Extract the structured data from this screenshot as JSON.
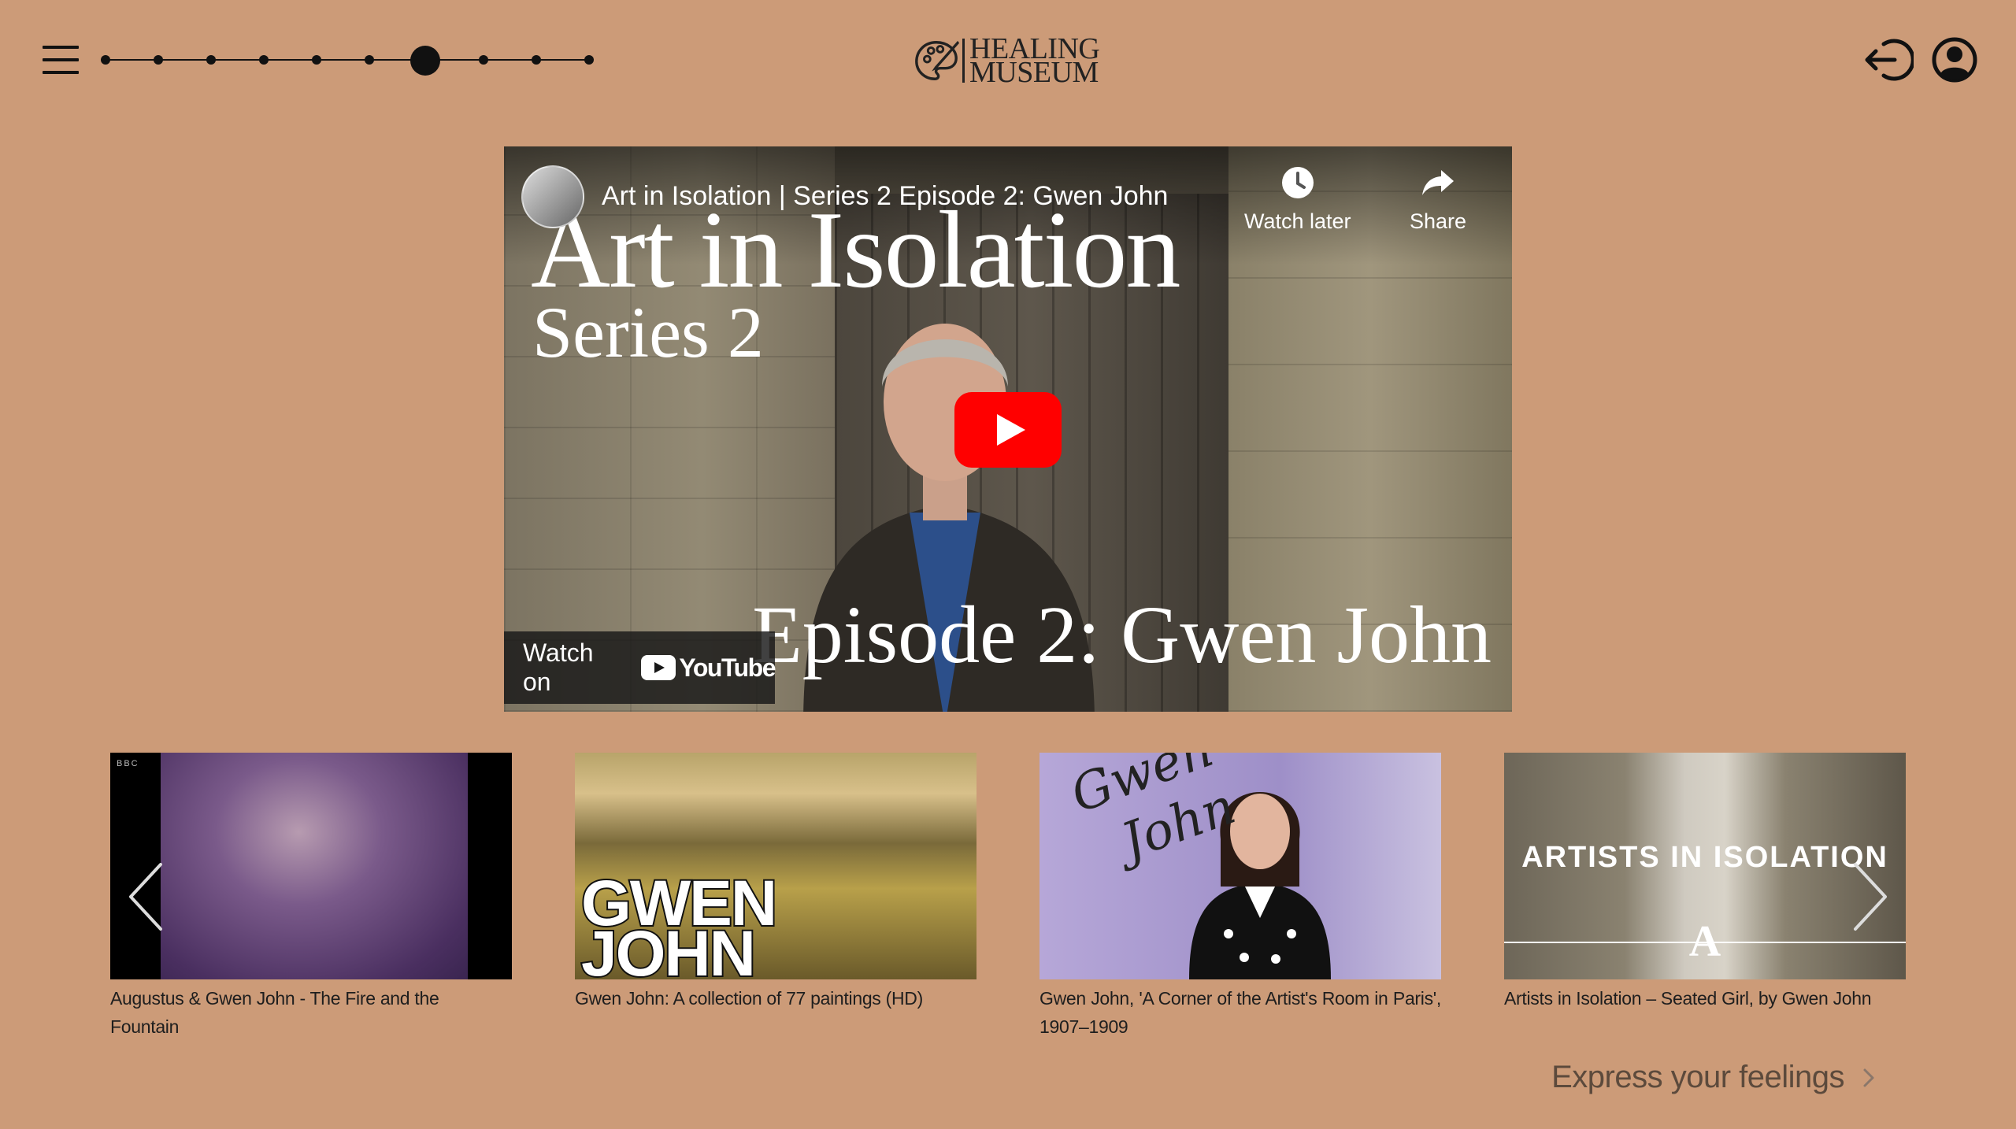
{
  "header": {
    "menu_icon": "hamburger-icon",
    "progress": {
      "total_steps": 10,
      "current_step": 7
    },
    "logo": {
      "line1": "HEALING",
      "line2": "MUSEUM",
      "icon": "palette-icon"
    },
    "logout_icon": "logout-icon",
    "profile_icon": "user-circle-icon"
  },
  "video": {
    "title": "Art in Isolation | Series 2 Episode 2: Gwen John",
    "big_title": "Art in Isolation",
    "series_text": "Series 2",
    "episode_text": "Episode 2: Gwen John",
    "watch_later_label": "Watch later",
    "share_label": "Share",
    "watch_on_label": "Watch on",
    "youtube_label": "YouTube",
    "play_color": "#ff0000"
  },
  "carousel": {
    "cards": [
      {
        "caption": "Augustus & Gwen John - The Fire and the Fountain",
        "overlay": "BBC"
      },
      {
        "caption": "Gwen John: A collection of 77 paintings (HD)",
        "overlay_line1": "GWEN",
        "overlay_line2": "JOHN"
      },
      {
        "caption": "Gwen John, 'A Corner of the Artist's Room in Paris', 1907–1909",
        "overlay_line1": "Gwen",
        "overlay_line2": "John"
      },
      {
        "caption": "Artists in Isolation – Seated Girl, by Gwen John",
        "overlay": "ARTISTS IN ISOLATION",
        "mark": "A"
      }
    ]
  },
  "footer": {
    "express_label": "Express your feelings"
  },
  "colors": {
    "background": "#cc9b78",
    "text": "#222222",
    "link": "#5c4a3c"
  }
}
